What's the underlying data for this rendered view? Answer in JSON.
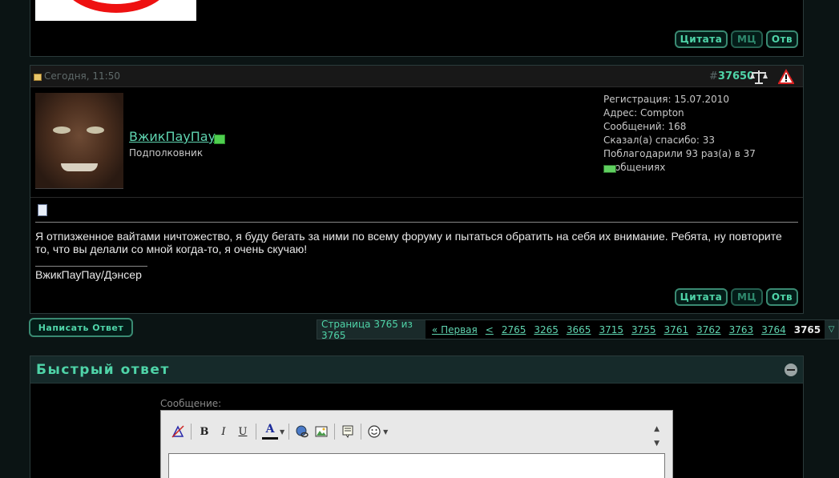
{
  "post_buttons": {
    "quote": "Цитата",
    "multiquote": "МЦ",
    "reply": "Отв"
  },
  "post": {
    "date": "Сегодня, 11:50",
    "number_prefix": "#",
    "number": "37650",
    "username": "ВжикПауПау",
    "user_title": "Подполковник",
    "info": {
      "registration": "Регистрация: 15.07.2010",
      "address": "Адрес: Compton",
      "messages": "Сообщений: 168",
      "thanks_said": "Сказал(а) спасибо: 33",
      "thanked": "Поблагодарили 93 раз(а) в 37 сообщениях"
    },
    "text": "Я отпизженное вайтами ничтожество, я буду бегать за ними по всему форуму и пытаться обратить на себя их внимание. Ребята, ну повторите то, что вы делали со мной когда-то, я очень скучаю!",
    "signature": "ВжикПауПау/Дэнсер"
  },
  "new_thread_label": "Написать Ответ",
  "pagination": {
    "info": "Страница 3765 из 3765",
    "first": "« Первая",
    "prev": "<",
    "pages": [
      "2765",
      "3265",
      "3665",
      "3715",
      "3755",
      "3761",
      "3762",
      "3763",
      "3764"
    ],
    "current": "3765"
  },
  "quick_reply": {
    "title": "Быстрый ответ",
    "message_label": "Сообщение:"
  },
  "toolbar": {
    "bold": "B",
    "italic": "I",
    "underline": "U",
    "color": "A"
  },
  "colors": {
    "accent": "#4fd4a8",
    "background": "#000000",
    "header": "#162a2a"
  }
}
